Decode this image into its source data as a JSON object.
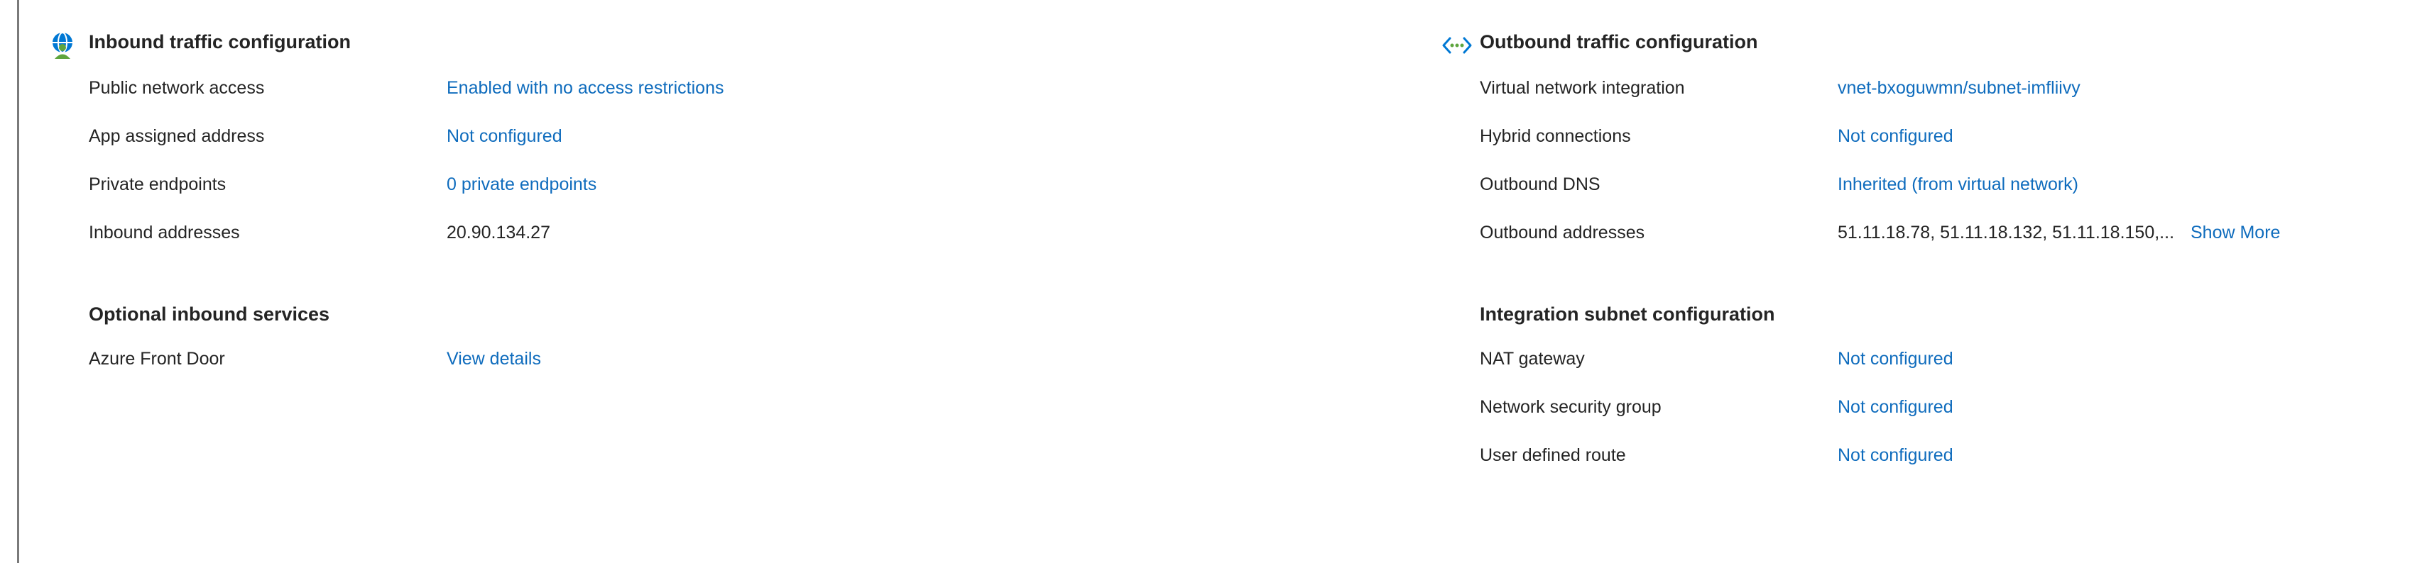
{
  "inbound": {
    "title": "Inbound traffic configuration",
    "rows": [
      {
        "label": "Public network access",
        "value": "Enabled with no access restrictions"
      },
      {
        "label": "App assigned address",
        "value": "Not configured"
      },
      {
        "label": "Private endpoints",
        "value": "0 private endpoints"
      },
      {
        "label": "Inbound addresses",
        "value": "20.90.134.27"
      }
    ],
    "optional_title": "Optional inbound services",
    "optional_rows": [
      {
        "label": "Azure Front Door",
        "value": "View details"
      }
    ]
  },
  "outbound": {
    "title": "Outbound traffic configuration",
    "rows": [
      {
        "label": "Virtual network integration",
        "value": "vnet-bxoguwmn/subnet-imfliivy"
      },
      {
        "label": "Hybrid connections",
        "value": "Not configured"
      },
      {
        "label": "Outbound DNS",
        "value": "Inherited (from virtual network)"
      },
      {
        "label": "Outbound addresses",
        "value": "51.11.18.78, 51.11.18.132, 51.11.18.150,...",
        "show_more": "Show More"
      }
    ],
    "subnet_title": "Integration subnet configuration",
    "subnet_rows": [
      {
        "label": "NAT gateway",
        "value": "Not configured"
      },
      {
        "label": "Network security group",
        "value": "Not configured"
      },
      {
        "label": "User defined route",
        "value": "Not configured"
      }
    ]
  },
  "icons": {
    "inbound": "globe-person-icon",
    "outbound": "outbound-arrows-icon"
  },
  "colors": {
    "link": "#0f6cbd",
    "text": "#242424",
    "icon_blue": "#0078d4",
    "icon_green": "#5ea53d"
  }
}
